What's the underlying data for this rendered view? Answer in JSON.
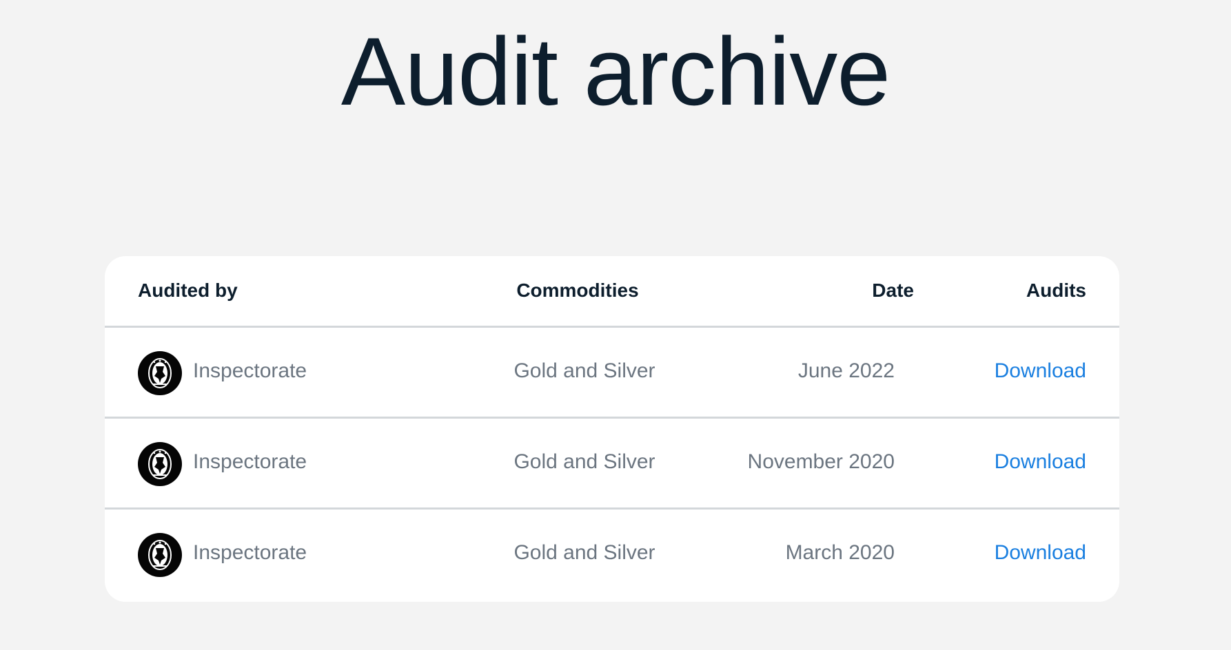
{
  "page": {
    "title": "Audit archive"
  },
  "table": {
    "headers": {
      "audited_by": "Audited by",
      "commodities": "Commodities",
      "date": "Date",
      "audits": "Audits"
    },
    "rows": [
      {
        "auditor": "Inspectorate",
        "logo_icon": "bureau-veritas-seal-icon",
        "commodities": "Gold and Silver",
        "date": "June 2022",
        "audit_link": "Download"
      },
      {
        "auditor": "Inspectorate",
        "logo_icon": "bureau-veritas-seal-icon",
        "commodities": "Gold and Silver",
        "date": "November 2020",
        "audit_link": "Download"
      },
      {
        "auditor": "Inspectorate",
        "logo_icon": "bureau-veritas-seal-icon",
        "commodities": "Gold and Silver",
        "date": "March 2020",
        "audit_link": "Download"
      }
    ]
  },
  "colors": {
    "background": "#f3f3f3",
    "card": "#ffffff",
    "heading": "#0d1e2d",
    "muted_text": "#6b7580",
    "link": "#1a7fe0",
    "divider": "#d3d7da"
  }
}
